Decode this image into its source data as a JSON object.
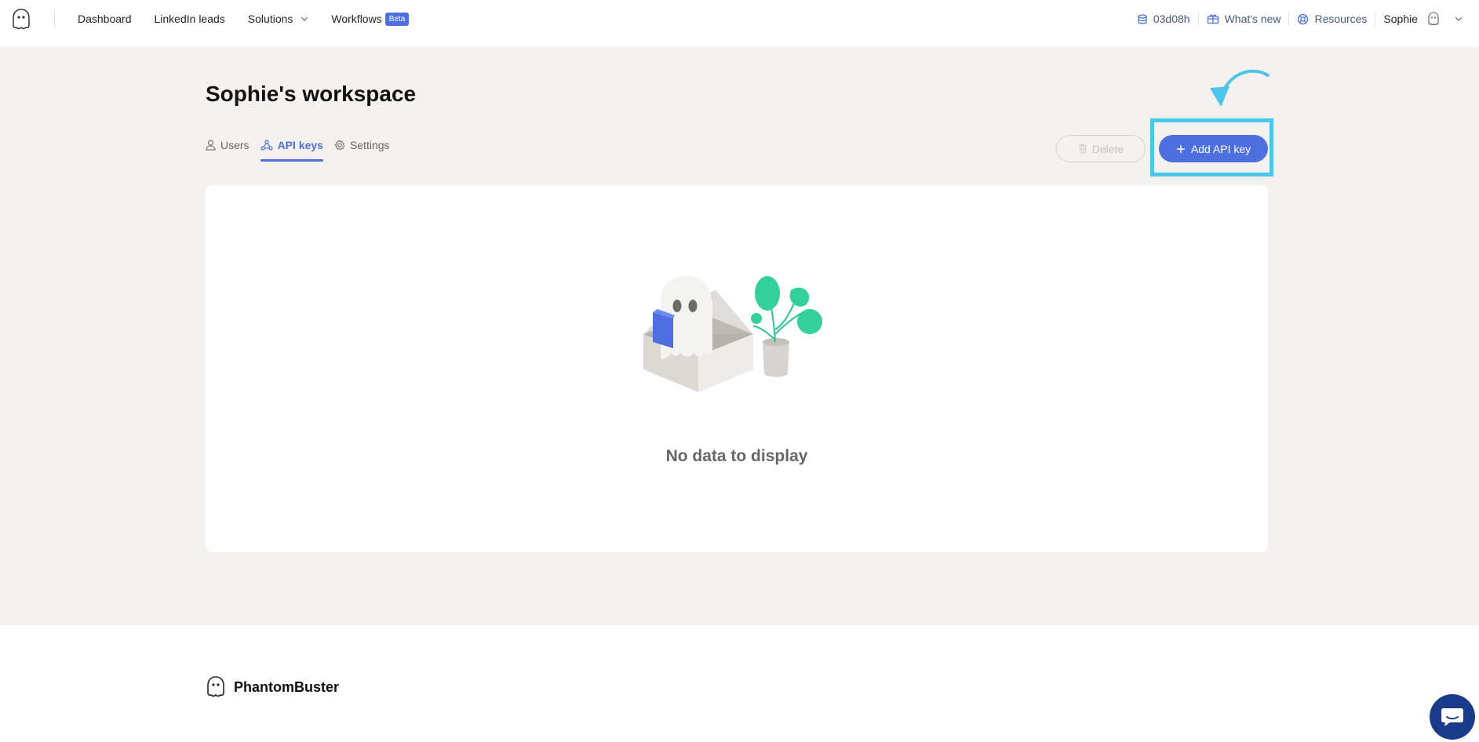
{
  "nav": {
    "links": [
      {
        "label": "Dashboard"
      },
      {
        "label": "LinkedIn leads"
      },
      {
        "label": "Solutions"
      },
      {
        "label": "Workflows",
        "badge": "Beta"
      }
    ],
    "time_remaining": "03d08h",
    "whats_new": "What's new",
    "resources": "Resources",
    "user_name": "Sophie"
  },
  "page": {
    "title": "Sophie's workspace",
    "tabs": [
      {
        "label": "Users",
        "icon": "user-icon"
      },
      {
        "label": "API keys",
        "icon": "api-icon",
        "active": true
      },
      {
        "label": "Settings",
        "icon": "gear-icon"
      }
    ],
    "delete_label": "Delete",
    "add_label": "Add API key",
    "empty_text": "No data to display"
  },
  "footer": {
    "brand": "PhantomBuster"
  },
  "colors": {
    "accent": "#4e6fe0",
    "highlight": "#4cc6ea",
    "background": "#f4f1ee",
    "chat": "#1a3a8c"
  }
}
